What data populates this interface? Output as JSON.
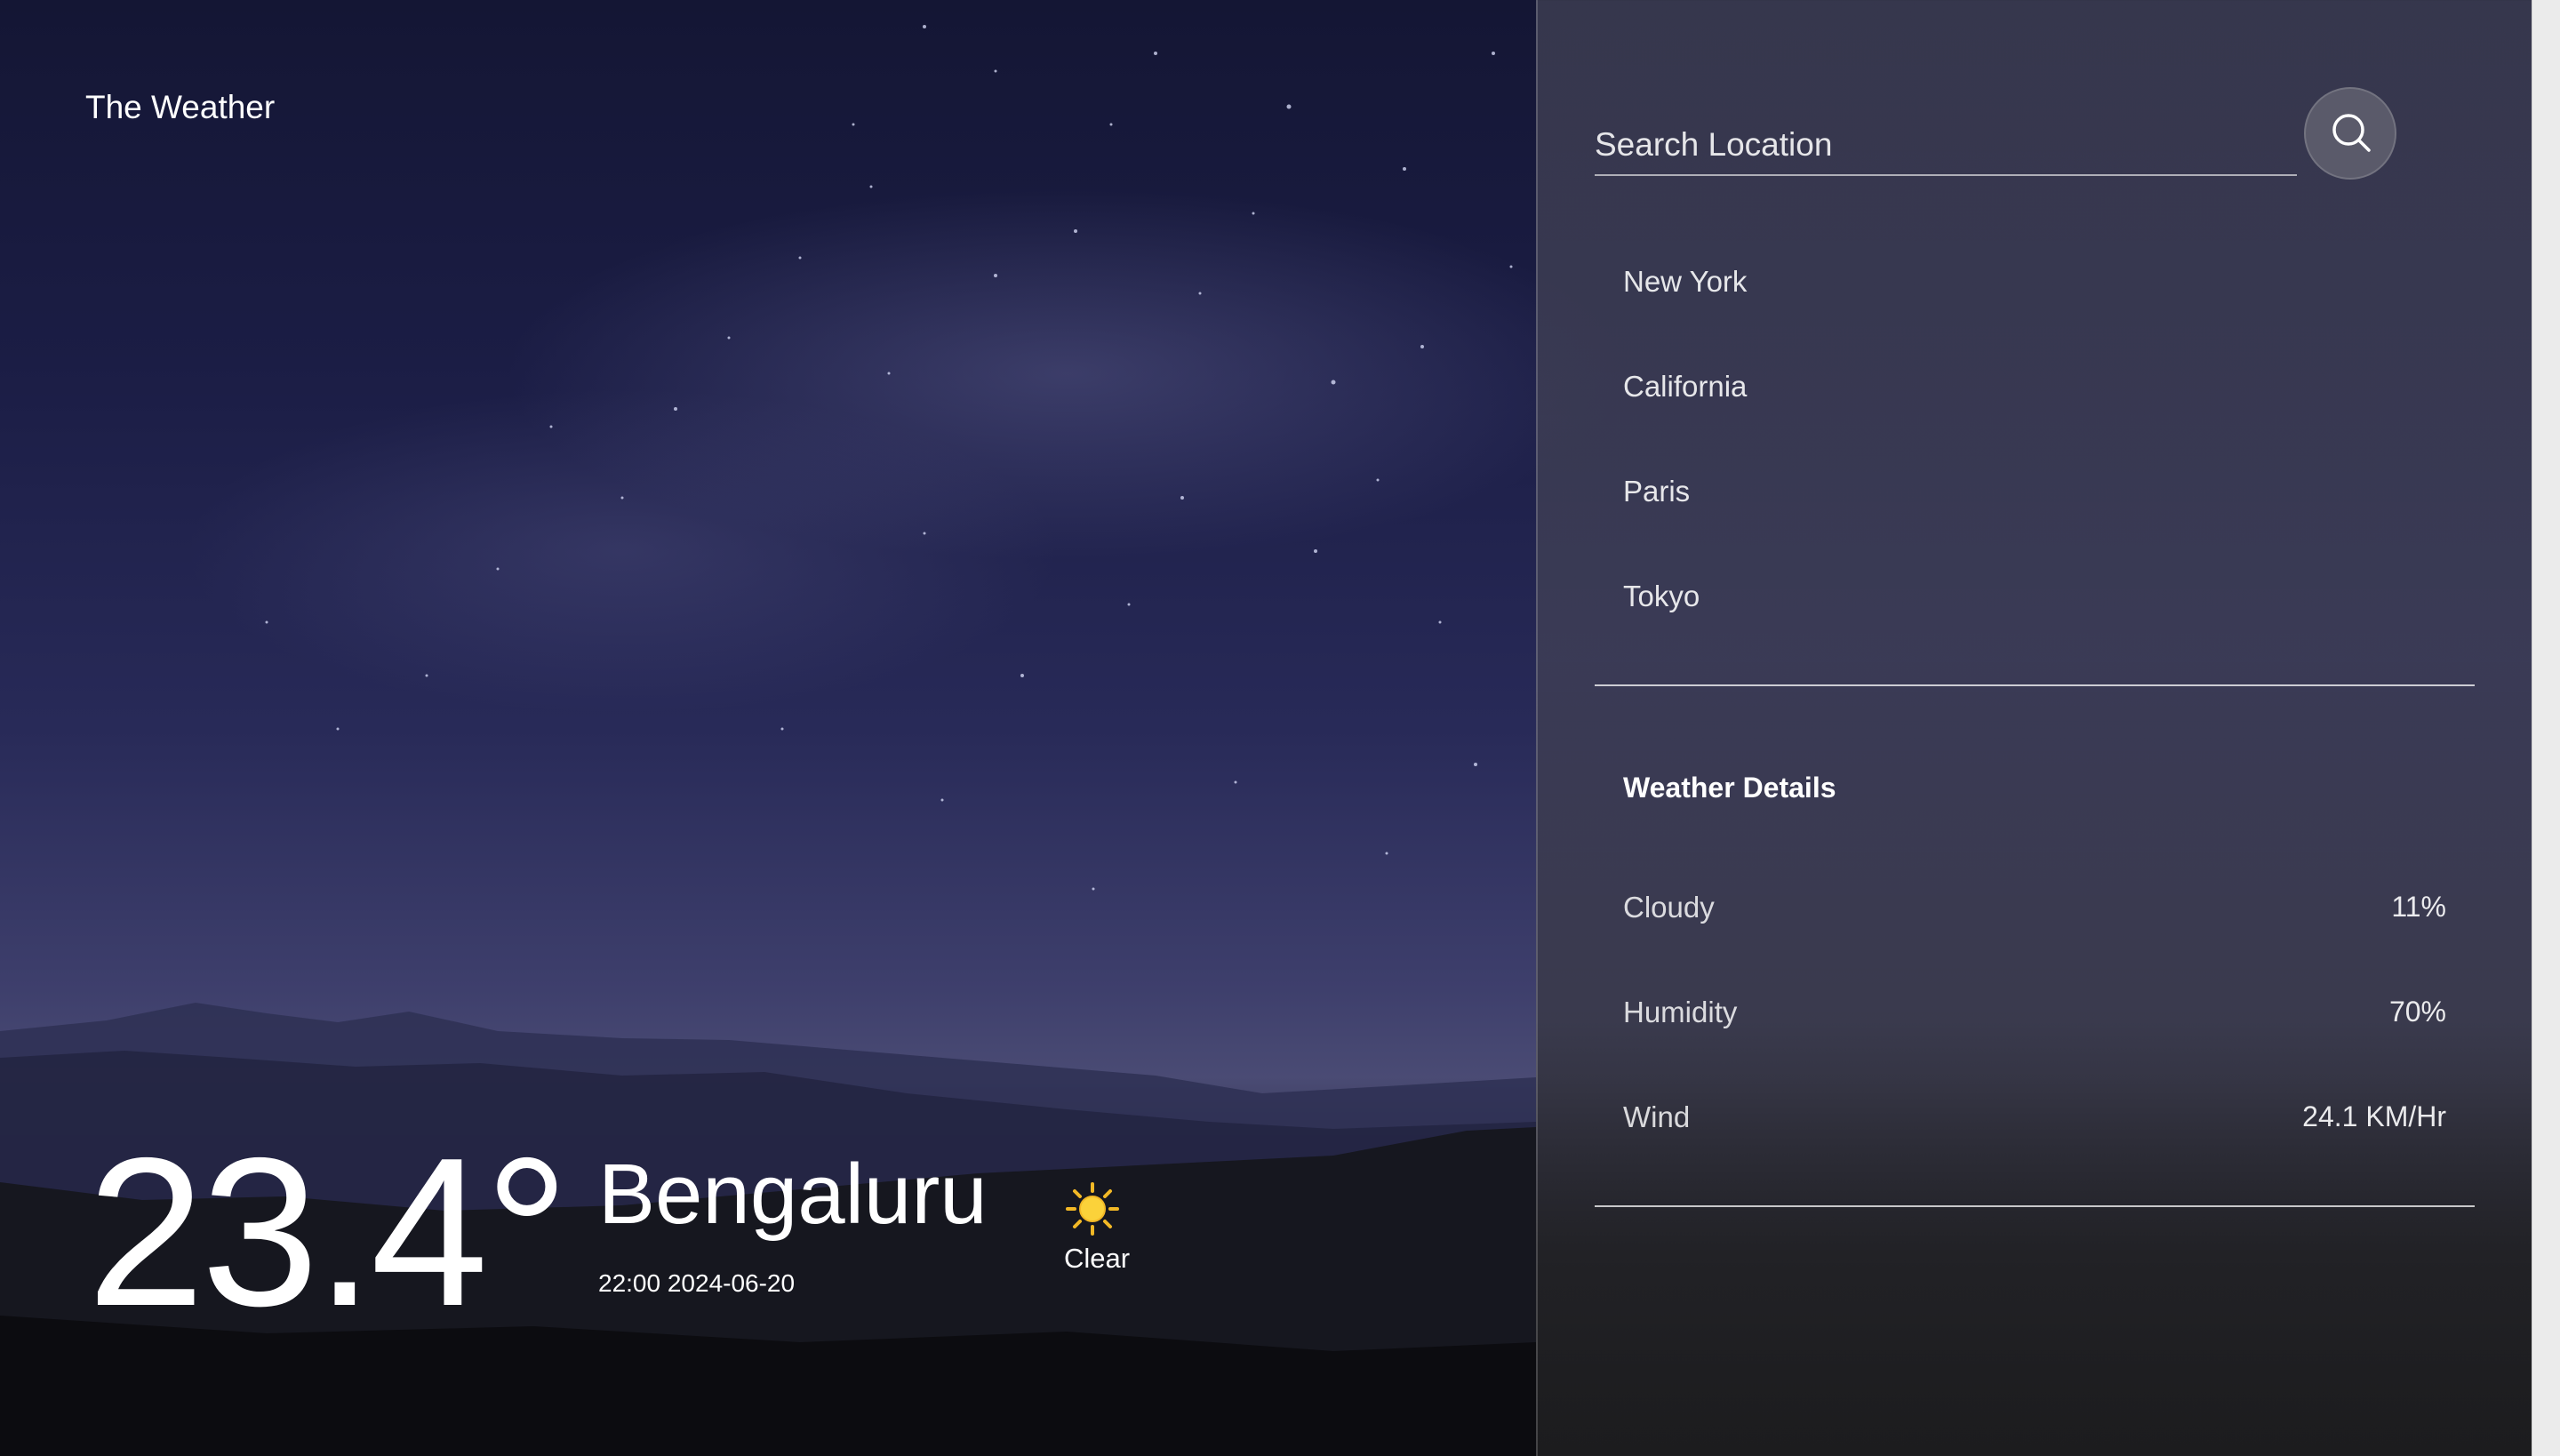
{
  "app": {
    "brand": "The Weather"
  },
  "current": {
    "temperature": "23.4°",
    "city": "Bengaluru",
    "datetime": "22:00 2024-06-20",
    "condition": "Clear",
    "condition_icon": "sun-icon"
  },
  "search": {
    "placeholder": "Search Location",
    "value": "",
    "button_icon": "search-icon"
  },
  "locations": [
    "New York",
    "California",
    "Paris",
    "Tokyo"
  ],
  "details": {
    "title": "Weather Details",
    "items": [
      {
        "label": "Cloudy",
        "value": "11%"
      },
      {
        "label": "Humidity",
        "value": "70%"
      },
      {
        "label": "Wind",
        "value": "24.1 KM/Hr"
      }
    ]
  }
}
